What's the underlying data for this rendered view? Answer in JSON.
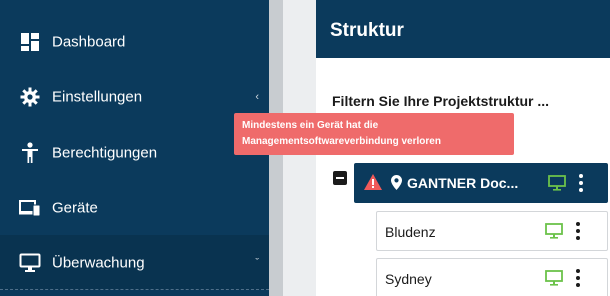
{
  "sidebar": {
    "items": [
      {
        "label": "Dashboard",
        "icon": "dashboard-icon"
      },
      {
        "label": "Einstellungen",
        "icon": "gear-icon",
        "chevron": "‹"
      },
      {
        "label": "Berechtigungen",
        "icon": "person-icon"
      },
      {
        "label": "Geräte",
        "icon": "devices-icon"
      },
      {
        "label": "Überwachung",
        "icon": "monitor-icon",
        "chevron": "ˇ"
      }
    ]
  },
  "panel": {
    "title": "Struktur",
    "filter_label": "Filtern Sie Ihre Projektstruktur ..."
  },
  "tooltip": {
    "line1": "Mindestens ein Gerät hat die",
    "line2": "Managementsoftwareverbindung verloren"
  },
  "tree": {
    "root": {
      "name": "GANTNER Doc...",
      "status_icon": "warning-icon"
    },
    "children": [
      {
        "name": "Bludenz"
      },
      {
        "name": "Sydney"
      }
    ]
  },
  "colors": {
    "sidebar_bg": "#0b3a5c",
    "tooltip_bg": "#ef6b6b",
    "warning": "#f05a5a",
    "monitor_ok": "#6cc24a"
  }
}
